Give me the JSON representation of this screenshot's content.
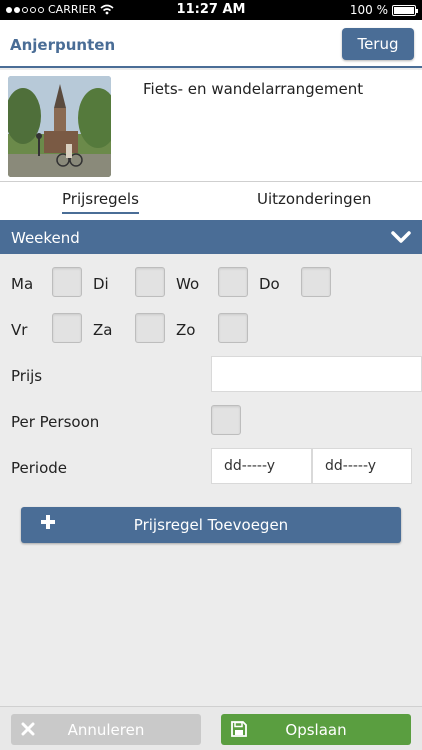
{
  "status_bar": {
    "carrier": "CARRIER",
    "time": "11:27 AM",
    "battery": "100 %",
    "battery_level": 1.0
  },
  "header": {
    "title": "Anjerpunten",
    "back_label": "Terug"
  },
  "arrangement": {
    "title": "Fiets- en wandelarrangement"
  },
  "tabs": {
    "active": "Prijsregels",
    "other": "Uitzonderingen"
  },
  "section": {
    "label": "Weekend"
  },
  "days": {
    "ma": "Ma",
    "di": "Di",
    "wo": "Wo",
    "do": "Do",
    "vr": "Vr",
    "za": "Za",
    "zo": "Zo"
  },
  "form": {
    "price_label": "Prijs",
    "price_value": "",
    "per_person_label": "Per Persoon",
    "period_label": "Periode",
    "date_from_placeholder": "dd-----y",
    "date_to_placeholder": "dd-----y"
  },
  "add_button": {
    "label": "Prijsregel Toevoegen"
  },
  "footer": {
    "cancel_label": "Annuleren",
    "save_label": "Opslaan"
  },
  "colors": {
    "primary": "#4a6d96",
    "save": "#5a9e40",
    "cancel": "#c9c9c9"
  }
}
